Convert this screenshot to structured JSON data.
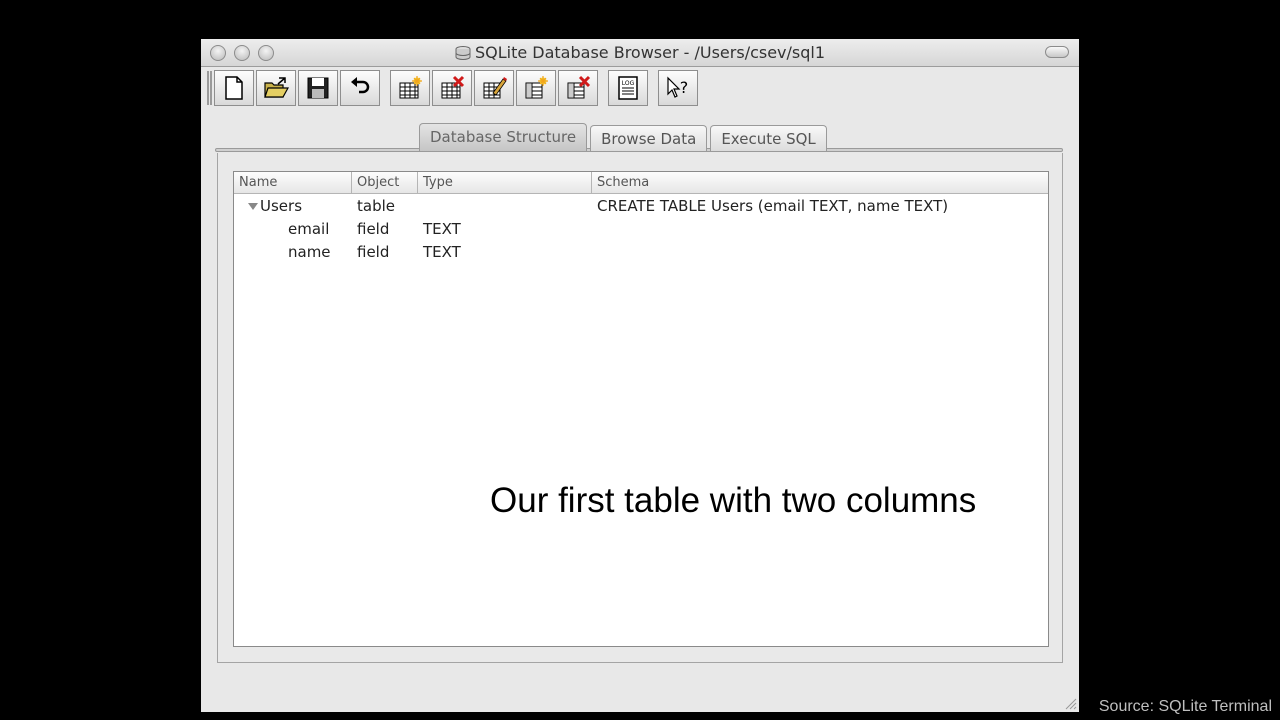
{
  "window": {
    "title": "SQLite Database Browser - /Users/csev/sql1"
  },
  "toolbar": {
    "buttons": [
      {
        "name": "new-database",
        "icon": "new-document-icon"
      },
      {
        "name": "open-database",
        "icon": "open-folder-icon"
      },
      {
        "name": "save-database",
        "icon": "floppy-disk-icon"
      },
      {
        "name": "undo",
        "icon": "undo-arrow-icon"
      },
      {
        "name": "create-table",
        "icon": "create-table-icon"
      },
      {
        "name": "delete-table",
        "icon": "delete-table-icon"
      },
      {
        "name": "modify-table",
        "icon": "modify-table-icon"
      },
      {
        "name": "create-index",
        "icon": "create-index-icon"
      },
      {
        "name": "delete-index",
        "icon": "delete-index-icon"
      },
      {
        "name": "sql-log",
        "icon": "log-icon"
      },
      {
        "name": "whats-this",
        "icon": "help-cursor-icon"
      }
    ],
    "log_label": "LOG",
    "help_glyph": "?"
  },
  "tabs": [
    {
      "label": "Database Structure",
      "active": true
    },
    {
      "label": "Browse Data",
      "active": false
    },
    {
      "label": "Execute SQL",
      "active": false
    }
  ],
  "tree": {
    "columns": [
      "Name",
      "Object",
      "Type",
      "Schema"
    ],
    "rows": [
      {
        "name": "Users",
        "object": "table",
        "type": "",
        "schema": "CREATE TABLE Users (email TEXT, name TEXT)",
        "expanded": true,
        "level": 0
      },
      {
        "name": "email",
        "object": "field",
        "type": "TEXT",
        "schema": "",
        "level": 1
      },
      {
        "name": "name",
        "object": "field",
        "type": "TEXT",
        "schema": "",
        "level": 1
      }
    ]
  },
  "caption": "Our first table with two columns",
  "source": "Source: SQLite Terminal"
}
